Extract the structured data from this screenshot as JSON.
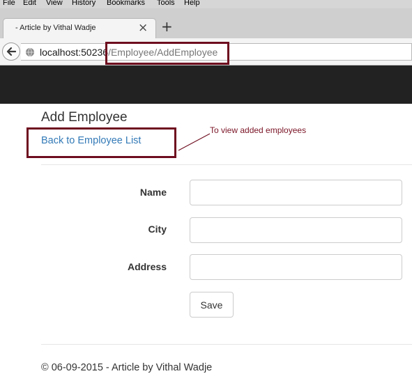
{
  "menu": [
    "File",
    "Edit",
    "View",
    "History",
    "Bookmarks",
    "Tools",
    "Help"
  ],
  "tab": {
    "title": "- Article by Vithal Wadje",
    "close": "×",
    "new_tab": "+"
  },
  "address": {
    "host": "localhost:50236",
    "path": "/Employee/AddEmployee"
  },
  "page": {
    "title": "Add Employee",
    "back_link": "Back to Employee List",
    "annotation": "To view added employees"
  },
  "form": {
    "fields": [
      {
        "label": "Name",
        "value": ""
      },
      {
        "label": "City",
        "value": ""
      },
      {
        "label": "Address",
        "value": ""
      }
    ],
    "save_label": "Save"
  },
  "footer": {
    "text": "© 06-09-2015 - Article by Vithal Wadje"
  },
  "colors": {
    "highlight_border": "#6e0d1f",
    "link": "#337ab7",
    "site_navbar": "#222222"
  },
  "icons": {
    "back": "arrow-left-icon",
    "site_info": "globe-icon",
    "close": "close-icon",
    "new_tab": "plus-icon"
  }
}
